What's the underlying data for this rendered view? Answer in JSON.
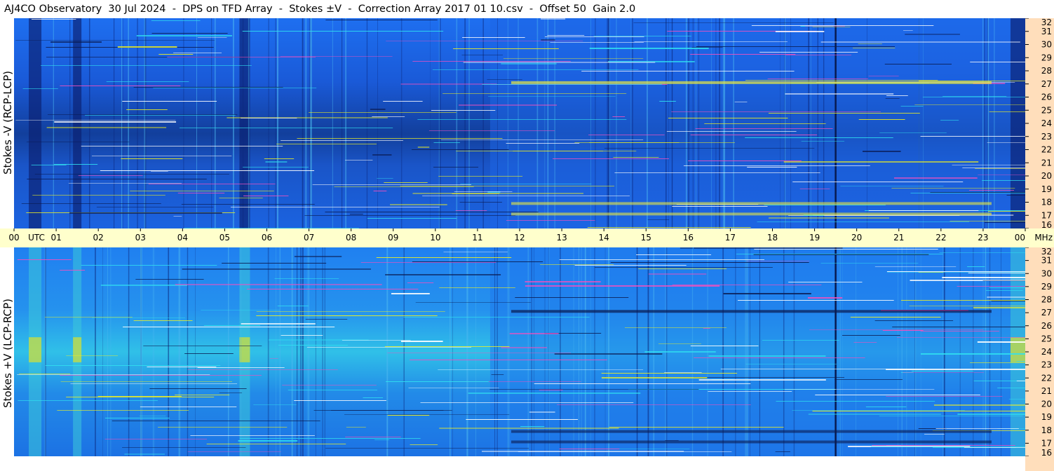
{
  "title": "AJ4CO Observatory  30 Jul 2024  -  DPS on TFD Array  -  Stokes ±V  -  Correction Array 2017 01 10.csv  -  Offset 50  Gain 2.0",
  "colors": {
    "background_low": "#0a1f6e",
    "background_mid": "#1a5fe0",
    "background_high": "#2fb0f0",
    "hot": "#f0f020",
    "time_axis_bg": "#ffffcc",
    "freq_axis_bg": "#ffdebb"
  },
  "chart_data": [
    {
      "type": "heatmap",
      "name": "Stokes -V (RCP-LCP)",
      "ylabel": "Stokes -V (RCP-LCP)",
      "x_ticks": [
        "00",
        "UTC",
        "01",
        "02",
        "03",
        "04",
        "05",
        "06",
        "07",
        "08",
        "09",
        "10",
        "11",
        "12",
        "13",
        "14",
        "15",
        "16",
        "17",
        "18",
        "19",
        "20",
        "21",
        "22",
        "23",
        "00"
      ],
      "x_unit": "UTC",
      "y_ticks": [
        "16",
        "17",
        "18",
        "19",
        "20",
        "21",
        "22",
        "23",
        "24",
        "25",
        "26",
        "27",
        "28",
        "29",
        "30",
        "31",
        "32"
      ],
      "y_unit": "MHz",
      "ylim": [
        16,
        32
      ],
      "xlim_hours": [
        0,
        24
      ]
    },
    {
      "type": "heatmap",
      "name": "Stokes +V (LCP-RCP)",
      "ylabel": "Stokes +V (LCP-RCP)",
      "x_ticks": [
        "00",
        "UTC",
        "01",
        "02",
        "03",
        "04",
        "05",
        "06",
        "07",
        "08",
        "09",
        "10",
        "11",
        "12",
        "13",
        "14",
        "15",
        "16",
        "17",
        "18",
        "19",
        "20",
        "21",
        "22",
        "23",
        "00"
      ],
      "x_unit": "UTC",
      "y_ticks": [
        "16",
        "17",
        "18",
        "19",
        "20",
        "21",
        "22",
        "23",
        "24",
        "25",
        "26",
        "27",
        "28",
        "29",
        "30",
        "31",
        "32"
      ],
      "y_unit": "MHz",
      "ylim": [
        16,
        32
      ],
      "xlim_hours": [
        0,
        24
      ]
    }
  ],
  "time_axis": {
    "hour_labels": [
      "00",
      "01",
      "02",
      "03",
      "04",
      "05",
      "06",
      "07",
      "08",
      "09",
      "10",
      "11",
      "12",
      "13",
      "14",
      "15",
      "16",
      "17",
      "18",
      "19",
      "20",
      "21",
      "22",
      "23",
      "00"
    ],
    "utc_label": "UTC",
    "mhz_label": "MHz"
  }
}
